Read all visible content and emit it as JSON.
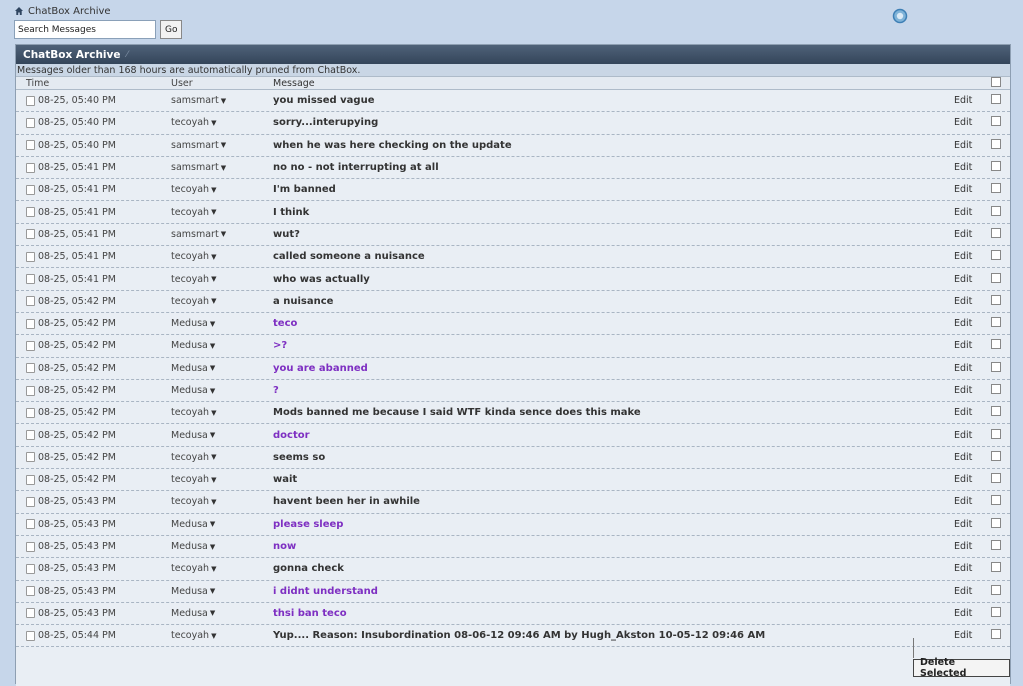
{
  "breadcrumb": {
    "label": "ChatBox Archive"
  },
  "search": {
    "value": "Search Messages",
    "go_label": "Go"
  },
  "panel": {
    "title": "ChatBox Archive",
    "notice": "Messages older than 168 hours are automatically pruned from ChatBox."
  },
  "columns": {
    "time": "Time",
    "user": "User",
    "message": "Message"
  },
  "edit_label": "Edit",
  "delete_label": "Delete Selected",
  "colors": {
    "purple_message": "#7e2fc2",
    "header_bg": "#3c4d63"
  },
  "rows": [
    {
      "time": "08-25, 05:40 PM",
      "user": "samsmart",
      "message": "you missed vague",
      "purple": false
    },
    {
      "time": "08-25, 05:40 PM",
      "user": "tecoyah",
      "message": "sorry...interupying",
      "purple": false
    },
    {
      "time": "08-25, 05:40 PM",
      "user": "samsmart",
      "message": "when he was here checking on the update",
      "purple": false
    },
    {
      "time": "08-25, 05:41 PM",
      "user": "samsmart",
      "message": "no no - not interrupting at all",
      "purple": false
    },
    {
      "time": "08-25, 05:41 PM",
      "user": "tecoyah",
      "message": "I'm banned",
      "purple": false
    },
    {
      "time": "08-25, 05:41 PM",
      "user": "tecoyah",
      "message": "I think",
      "purple": false
    },
    {
      "time": "08-25, 05:41 PM",
      "user": "samsmart",
      "message": "wut?",
      "purple": false
    },
    {
      "time": "08-25, 05:41 PM",
      "user": "tecoyah",
      "message": "called someone a nuisance",
      "purple": false
    },
    {
      "time": "08-25, 05:41 PM",
      "user": "tecoyah",
      "message": "who was actually",
      "purple": false
    },
    {
      "time": "08-25, 05:42 PM",
      "user": "tecoyah",
      "message": "a nuisance",
      "purple": false
    },
    {
      "time": "08-25, 05:42 PM",
      "user": "Medusa",
      "message": "teco",
      "purple": true
    },
    {
      "time": "08-25, 05:42 PM",
      "user": "Medusa",
      "message": ">?",
      "purple": true
    },
    {
      "time": "08-25, 05:42 PM",
      "user": "Medusa",
      "message": "you are abanned",
      "purple": true
    },
    {
      "time": "08-25, 05:42 PM",
      "user": "Medusa",
      "message": "?",
      "purple": true
    },
    {
      "time": "08-25, 05:42 PM",
      "user": "tecoyah",
      "message": "Mods banned me because I said WTF kinda sence does this make",
      "purple": false
    },
    {
      "time": "08-25, 05:42 PM",
      "user": "Medusa",
      "message": "doctor",
      "purple": true
    },
    {
      "time": "08-25, 05:42 PM",
      "user": "tecoyah",
      "message": "seems so",
      "purple": false
    },
    {
      "time": "08-25, 05:42 PM",
      "user": "tecoyah",
      "message": "wait",
      "purple": false
    },
    {
      "time": "08-25, 05:43 PM",
      "user": "tecoyah",
      "message": "havent been her in awhile",
      "purple": false
    },
    {
      "time": "08-25, 05:43 PM",
      "user": "Medusa",
      "message": "please sleep",
      "purple": true
    },
    {
      "time": "08-25, 05:43 PM",
      "user": "Medusa",
      "message": "now",
      "purple": true
    },
    {
      "time": "08-25, 05:43 PM",
      "user": "tecoyah",
      "message": "gonna check",
      "purple": false
    },
    {
      "time": "08-25, 05:43 PM",
      "user": "Medusa",
      "message": "i didnt understand",
      "purple": true
    },
    {
      "time": "08-25, 05:43 PM",
      "user": "Medusa",
      "message": "thsi ban teco",
      "purple": true
    },
    {
      "time": "08-25, 05:44 PM",
      "user": "tecoyah",
      "message": "Yup.... Reason: Insubordination 08-06-12 09:46 AM by Hugh_Akston 10-05-12 09:46 AM",
      "purple": false
    }
  ]
}
